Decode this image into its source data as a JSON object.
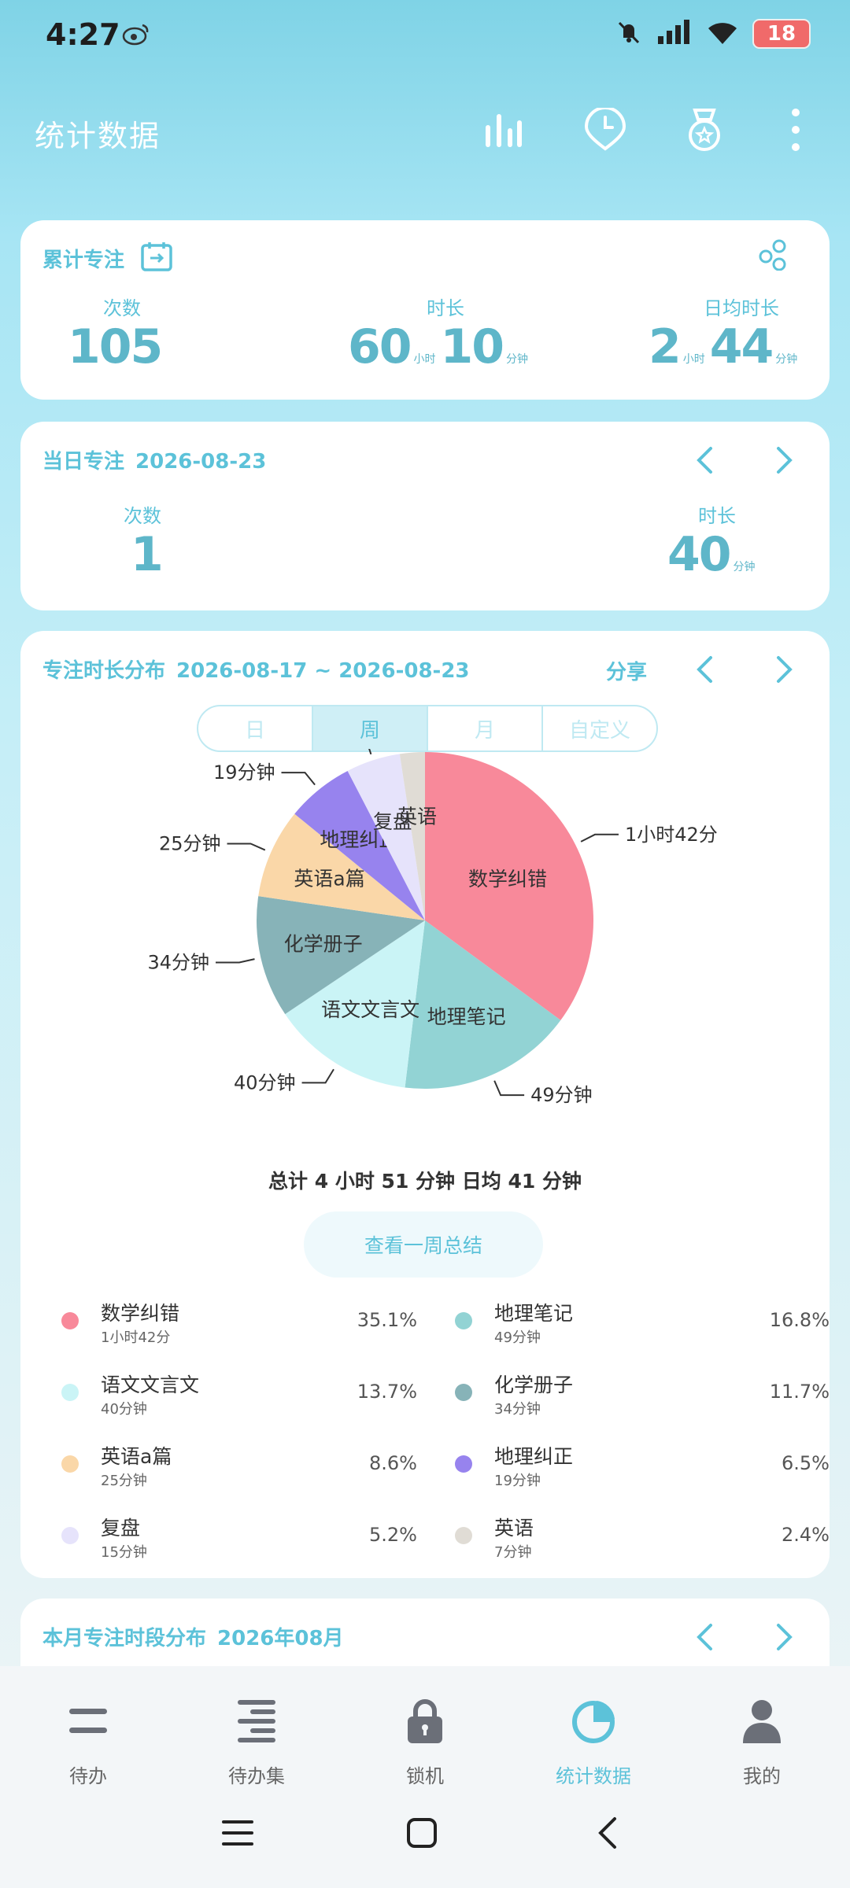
{
  "status": {
    "time": "4:27",
    "battery": "18"
  },
  "header": {
    "title": "统计数据"
  },
  "cumulative": {
    "title": "累计专注",
    "count_label": "次数",
    "count": "105",
    "duration_label": "时长",
    "dur_h": "60",
    "dur_h_unit": "小时",
    "dur_m": "10",
    "dur_m_unit": "分钟",
    "avg_label": "日均时长",
    "avg_h": "2",
    "avg_h_unit": "小时",
    "avg_m": "44",
    "avg_m_unit": "分钟"
  },
  "daily": {
    "title": "当日专注",
    "date": "2026-08-23",
    "count_label": "次数",
    "count": "1",
    "duration_label": "时长",
    "dur_m": "40",
    "dur_m_unit": "分钟"
  },
  "distribution": {
    "title": "专注时长分布",
    "range": "2026-08-17 ~ 2026-08-23",
    "share": "分享",
    "tabs": [
      "日",
      "周",
      "月",
      "自定义"
    ],
    "active_tab": "周",
    "summary": "总计 4 小时 51 分钟 日均 41 分钟",
    "summary_button": "查看一周总结"
  },
  "chart_data": {
    "type": "pie",
    "slices": [
      {
        "name": "数学纠错",
        "duration": "1小时42分",
        "percent": "35.1%",
        "value": 35.1,
        "color": "#f8899a"
      },
      {
        "name": "地理笔记",
        "duration": "49分钟",
        "percent": "16.8%",
        "value": 16.8,
        "color": "#92d3d4"
      },
      {
        "name": "语文文言文",
        "duration": "40分钟",
        "percent": "13.7%",
        "value": 13.7,
        "color": "#caf4f6"
      },
      {
        "name": "化学册子",
        "duration": "34分钟",
        "percent": "11.7%",
        "value": 11.7,
        "color": "#87b3b8"
      },
      {
        "name": "英语a篇",
        "duration": "25分钟",
        "percent": "8.6%",
        "value": 8.6,
        "color": "#fad7a8"
      },
      {
        "name": "地理纠正",
        "duration": "19分钟",
        "percent": "6.5%",
        "value": 6.5,
        "color": "#9783ee"
      },
      {
        "name": "复盘",
        "duration": "15分钟",
        "percent": "5.2%",
        "value": 5.2,
        "color": "#e6e3fb"
      },
      {
        "name": "英语",
        "duration": "7分钟",
        "percent": "2.4%",
        "value": 2.4,
        "color": "#e0dcd5"
      }
    ]
  },
  "monthly": {
    "title": "本月专注时段分布",
    "date": "2026年08月"
  },
  "bottom_nav": [
    {
      "label": "待办",
      "icon": "todo-icon"
    },
    {
      "label": "待办集",
      "icon": "todo-collection-icon"
    },
    {
      "label": "锁机",
      "icon": "lock-icon"
    },
    {
      "label": "统计数据",
      "icon": "statistics-icon"
    },
    {
      "label": "我的",
      "icon": "profile-icon"
    }
  ]
}
